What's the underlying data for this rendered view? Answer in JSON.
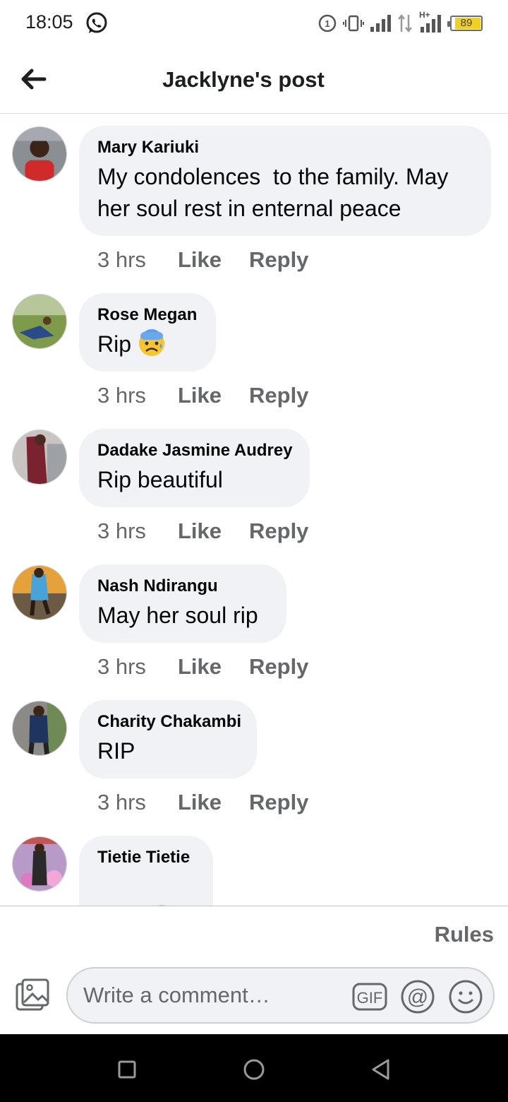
{
  "status_bar": {
    "time": "18:05",
    "notification_icon": "whatsapp-icon",
    "battery": "89",
    "network_label": "H+"
  },
  "header": {
    "back_icon": "arrow-left-icon",
    "title": "Jacklyne's post"
  },
  "comments": [
    {
      "author": "Mary Kariuki",
      "text": "My condolences  to the family. May her soul rest in enternal peace",
      "time": "3 hrs",
      "like_label": "Like",
      "reply_label": "Reply"
    },
    {
      "author": "Rose Megan",
      "text": "Rip",
      "emoji": [
        "anxious-face-with-sweat-emoji"
      ],
      "time": "3 hrs",
      "like_label": "Like",
      "reply_label": "Reply"
    },
    {
      "author": "Dadake Jasmine Audrey",
      "text": "Rip beautiful",
      "time": "3 hrs",
      "like_label": "Like",
      "reply_label": "Reply"
    },
    {
      "author": "Nash Ndirangu",
      "text": "May her soul rip",
      "time": "3 hrs",
      "like_label": "Like",
      "reply_label": "Reply"
    },
    {
      "author": "Charity Chakambi",
      "text": "RIP",
      "time": "3 hrs",
      "like_label": "Like",
      "reply_label": "Reply"
    },
    {
      "author": "Tietie Tietie",
      "text": "",
      "emoji": [
        "face-screaming-in-fear-emoji",
        "face-screaming-in-fear-emoji"
      ]
    }
  ],
  "composer": {
    "rules_label": "Rules",
    "placeholder": "Write a comment…",
    "photo_icon": "photo-icon",
    "gif_icon": "gif-icon",
    "mention_icon": "at-sign-icon",
    "emoji_icon": "smiley-icon"
  },
  "nav": {
    "recents_icon": "square-icon",
    "home_icon": "circle-icon",
    "back_icon": "triangle-back-icon"
  },
  "colors": {
    "bubble": "#f0f2f5",
    "secondary_text": "#65676b",
    "battery": "#f3d01f"
  }
}
